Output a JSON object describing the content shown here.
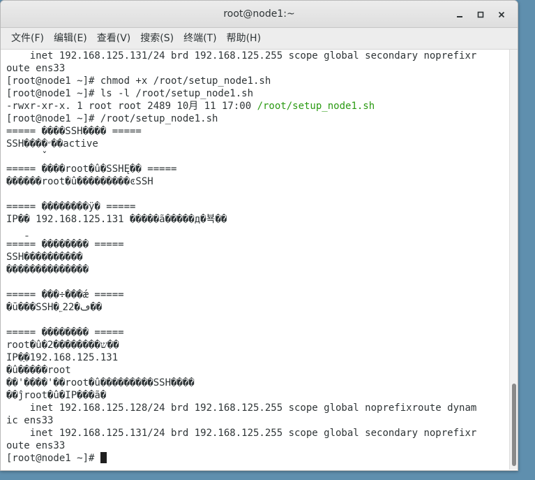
{
  "window": {
    "title": "root@node1:~"
  },
  "menu": [
    "文件(F)",
    "编辑(E)",
    "查看(V)",
    "搜索(S)",
    "终端(T)",
    "帮助(H)"
  ],
  "terminal": {
    "lines": [
      "    inet 192.168.125.131/24 brd 192.168.125.255 scope global secondary noprefixr",
      "oute ens33",
      "[root@node1 ~]# chmod +x /root/setup_node1.sh",
      "[root@node1 ~]# ls -l /root/setup_node1.sh",
      "-rwxr-xr-x. 1 root root 2489 10月 11 17:00 ",
      "[root@node1 ~]# /root/setup_node1.sh",
      "===== ����SSH���� =====",
      "SSH����״��active",
      "      ̌",
      "===== ����root�û�SSHĘ�� =====",
      "������root�û���������ͼSSH",
      "",
      "===== ��������ӱ� =====",
      "IP�� 192.168.125.131 �����ã�����д�뵥��",
      "   ̱",
      "===== �������� =====",
      "SSH����������",
      "��������������",
      "",
      "===== ���÷���ǽ =====",
      "�ū���SSH�˿ڡ�22��",
      "",
      "===== �������� =====",
      "root�û�2��������ש��",
      "IP�ַ�192.168.125.131",
      "�û�����root",
      "��'����'��root�û���������SSH����",
      "��ĵroot�û�IP���ã�",
      "    inet 192.168.125.128/24 brd 192.168.125.255 scope global noprefixroute dynam",
      "ic ens33",
      "    inet 192.168.125.131/24 brd 192.168.125.255 scope global secondary noprefixr",
      "oute ens33",
      "[root@node1 ~]# "
    ],
    "highlight_text": "/root/setup_node1.sh",
    "highlight_line": 4,
    "highlight_color": "#2a9a12"
  }
}
